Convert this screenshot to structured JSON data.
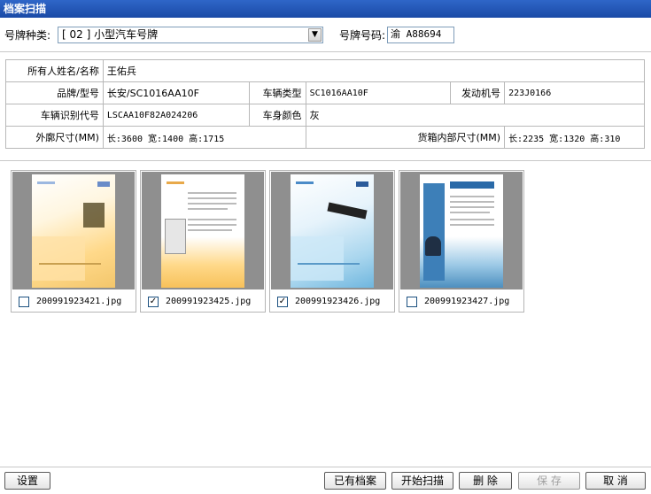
{
  "window": {
    "title": "档案扫描"
  },
  "plate": {
    "type_label": "号牌种类:",
    "type_value": "[ 02 ] 小型汽车号牌",
    "number_label": "号牌号码:",
    "number_value": "渝 A88694"
  },
  "info": {
    "owner_label": "所有人姓名/名称",
    "owner_value": "王佑兵",
    "brand_label": "品牌/型号",
    "brand_value": "长安/SC1016AA10F",
    "vtype_label": "车辆类型",
    "vtype_value": "SC1016AA10F",
    "engine_label": "发动机号",
    "engine_value": "223J0166",
    "vin_label": "车辆识别代号",
    "vin_value": "LSCAA10F82A024206",
    "color_label": "车身颜色",
    "color_value": "灰",
    "outer_label": "外廓尺寸(MM)",
    "outer_value": "长:3600 宽:1400 高:1715",
    "cargo_label": "货箱内部尺寸(MM)",
    "cargo_value": "长:2235 宽:1320 高:310"
  },
  "files": [
    {
      "name": "200991923421.jpg",
      "checked": false,
      "checkmark": ""
    },
    {
      "name": "200991923425.jpg",
      "checked": true,
      "checkmark": "✓"
    },
    {
      "name": "200991923426.jpg",
      "checked": true,
      "checkmark": "✓"
    },
    {
      "name": "200991923427.jpg",
      "checked": false,
      "checkmark": ""
    }
  ],
  "buttons": {
    "settings": "设置",
    "existing": "已有档案",
    "scan": "开始扫描",
    "delete": "删 除",
    "save": "保  存",
    "cancel": "取  消"
  },
  "icons": {
    "dropdown": "chevron-down-icon"
  }
}
